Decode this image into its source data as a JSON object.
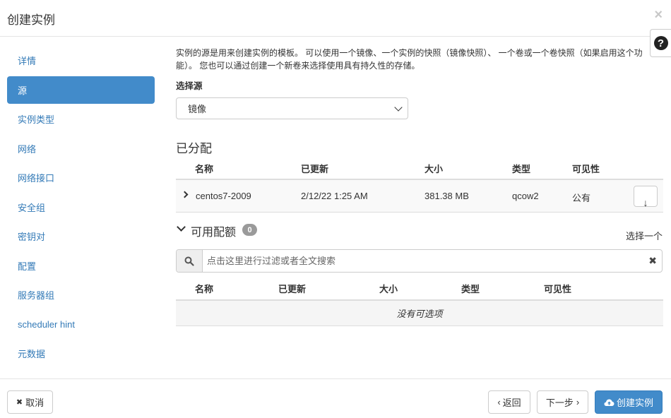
{
  "modal": {
    "title": "创建实例",
    "close": "×",
    "help": "?"
  },
  "sidebar": {
    "items": [
      {
        "label": "详情",
        "active": false
      },
      {
        "label": "源",
        "active": true
      },
      {
        "label": "实例类型",
        "active": false
      },
      {
        "label": "网络",
        "active": false
      },
      {
        "label": "网络接口",
        "active": false
      },
      {
        "label": "安全组",
        "active": false
      },
      {
        "label": "密钥对",
        "active": false
      },
      {
        "label": "配置",
        "active": false
      },
      {
        "label": "服务器组",
        "active": false
      },
      {
        "label": "scheduler hint",
        "active": false
      },
      {
        "label": "元数据",
        "active": false
      }
    ]
  },
  "source": {
    "description": "实例的源是用来创建实例的模板。 可以使用一个镜像、一个实例的快照（镜像快照）、 一个卷或一个卷快照（如果启用这个功能）。 您也可以通过创建一个新卷来选择使用具有持久性的存储。",
    "select_label": "选择源",
    "select_value": "镜像"
  },
  "allocated": {
    "title": "已分配",
    "columns": [
      "名称",
      "已更新",
      "大小",
      "类型",
      "可见性"
    ],
    "rows": [
      {
        "name": "centos7-2009",
        "updated": "2/12/22 1:25 AM",
        "size": "381.38 MB",
        "type": "qcow2",
        "visibility": "公有",
        "action": "↓"
      }
    ]
  },
  "available": {
    "title": "可用配额",
    "count": "0",
    "select_one": "选择一个",
    "search_placeholder": "点击这里进行过滤或者全文搜索",
    "search_clear": "✖",
    "columns": [
      "名称",
      "已更新",
      "大小",
      "类型",
      "可见性"
    ],
    "empty": "没有可选项"
  },
  "footer": {
    "cancel": "取消",
    "back": "返回",
    "next": "下一步",
    "create": "创建实例"
  },
  "colors": {
    "accent": "#428bca",
    "link": "#337ab7"
  }
}
